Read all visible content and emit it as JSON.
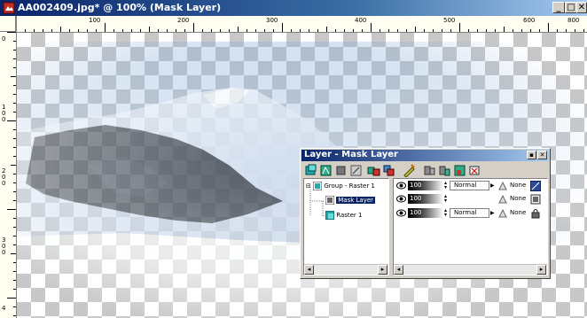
{
  "window": {
    "title": "AA002409.jpg* @ 100% (Mask Layer)",
    "controls": {
      "minimize": "_",
      "maximize": "□",
      "close": "✕"
    }
  },
  "ruler": {
    "horizontal": [
      "100",
      "200",
      "300",
      "400",
      "500",
      "600",
      "800"
    ],
    "vertical": [
      "0",
      "1 0 0",
      "2 0 0",
      "3 0 0",
      "4"
    ]
  },
  "layers_palette": {
    "title": "Layer - Mask Layer",
    "controls": {
      "minimize": "▪",
      "close": "✕"
    },
    "tree": [
      {
        "expander": "⊟",
        "label": "Group - Raster 1",
        "selected": false
      },
      {
        "label": "Mask Layer",
        "selected": true
      },
      {
        "label": "Raster 1",
        "selected": false
      }
    ],
    "rows": [
      {
        "opacity": "100",
        "blend": "Normal",
        "lock": "None"
      },
      {
        "opacity": "100",
        "blend": "",
        "lock": "None"
      },
      {
        "opacity": "100",
        "blend": "Normal",
        "lock": "None"
      }
    ]
  },
  "colors": {
    "titlebar_start": "#0a246a",
    "titlebar_end": "#a6caf0",
    "chrome": "#d4d0c8",
    "selection": "#0a246a",
    "ruler_bg": "#fffef0"
  }
}
